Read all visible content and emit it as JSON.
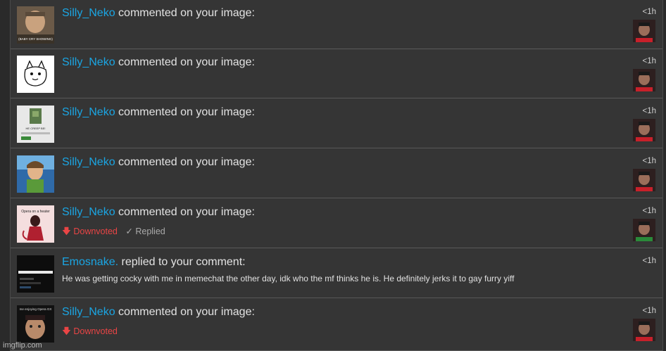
{
  "notifications": [
    {
      "user": "Silly_Neko",
      "action": "commented on your image:",
      "time": "<1h",
      "thumb": "photo-thumbnail",
      "thumb_caption": "(BABY CRY SHOWING)"
    },
    {
      "user": "Silly_Neko",
      "action": "commented on your image:",
      "time": "<1h",
      "thumb": "sketch-cat-thumbnail"
    },
    {
      "user": "Silly_Neko",
      "action": "commented on your image:",
      "time": "<1h",
      "thumb": "game-screen-thumbnail",
      "thumb_caption": "HE CREEP BE!"
    },
    {
      "user": "Silly_Neko",
      "action": "commented on your image:",
      "time": "<1h",
      "thumb": "cartoon-character-thumbnail"
    },
    {
      "user": "Silly_Neko",
      "action": "commented on your image:",
      "time": "<1h",
      "thumb": "fan-art-thumbnail",
      "thumb_caption": "Opera on a heater",
      "vote": "Downvoted",
      "status": "Replied"
    },
    {
      "user": "Emosnake.",
      "action": "replied to your comment:",
      "time": "<1h",
      "thumb": "dark-screenshot-thumbnail",
      "message": "He was getting cocky with me in memechat the other day, idk who the mf thinks he is. He definitely jerks it to gay furry yiff"
    },
    {
      "user": "Silly_Neko",
      "action": "commented on your image:",
      "time": "<1h",
      "thumb": "face-photo-thumbnail",
      "thumb_caption": "me enjoying Opera GX",
      "vote": "Downvoted"
    }
  ],
  "icons": {
    "downvote": "arrow-down-icon",
    "replied": "checkmark-icon"
  },
  "colors": {
    "username": "#1aa6e4",
    "downvote": "#ea4545",
    "background": "#333333"
  },
  "watermark": "imgflip.com"
}
